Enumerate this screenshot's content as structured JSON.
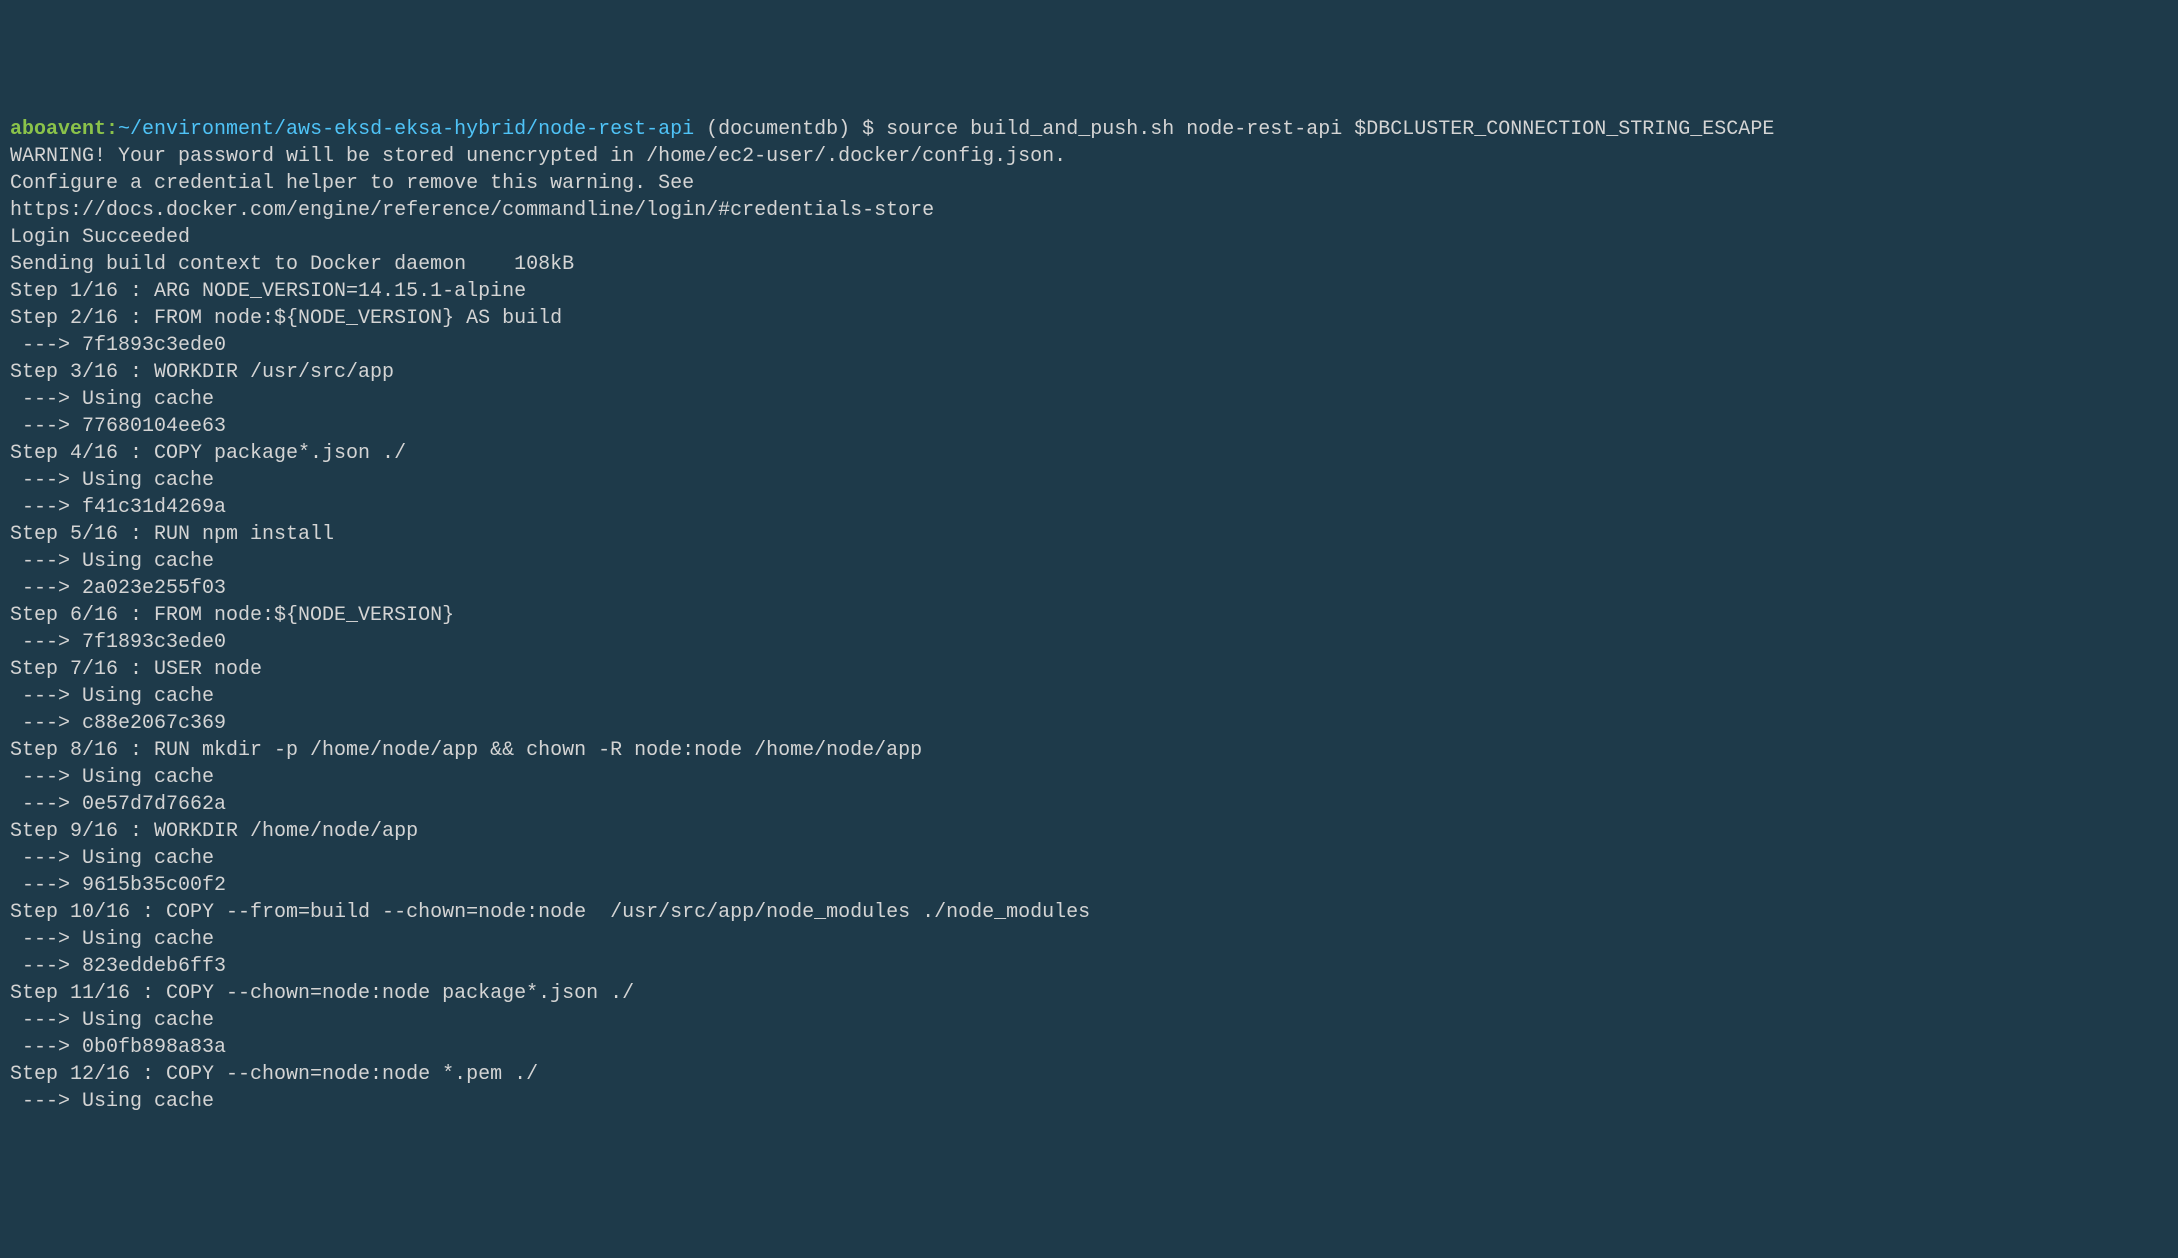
{
  "prompt": {
    "user": "aboavent",
    "separator": ":",
    "path": "~/environment/aws-eksd-eksa-hybrid/node-rest-api",
    "branch": " (documentdb) ",
    "symbol": "$ ",
    "command": "source build_and_push.sh node-rest-api $DBCLUSTER_CONNECTION_STRING_ESCAPE"
  },
  "lines": [
    "WARNING! Your password will be stored unencrypted in /home/ec2-user/.docker/config.json.",
    "Configure a credential helper to remove this warning. See",
    "https://docs.docker.com/engine/reference/commandline/login/#credentials-store",
    "",
    "Login Succeeded",
    "Sending build context to Docker daemon    108kB",
    "Step 1/16 : ARG NODE_VERSION=14.15.1-alpine",
    "Step 2/16 : FROM node:${NODE_VERSION} AS build",
    " ---> 7f1893c3ede0",
    "Step 3/16 : WORKDIR /usr/src/app",
    " ---> Using cache",
    " ---> 77680104ee63",
    "Step 4/16 : COPY package*.json ./",
    " ---> Using cache",
    " ---> f41c31d4269a",
    "Step 5/16 : RUN npm install",
    " ---> Using cache",
    " ---> 2a023e255f03",
    "Step 6/16 : FROM node:${NODE_VERSION}",
    " ---> 7f1893c3ede0",
    "Step 7/16 : USER node",
    " ---> Using cache",
    " ---> c88e2067c369",
    "Step 8/16 : RUN mkdir -p /home/node/app && chown -R node:node /home/node/app",
    " ---> Using cache",
    " ---> 0e57d7d7662a",
    "Step 9/16 : WORKDIR /home/node/app",
    " ---> Using cache",
    " ---> 9615b35c00f2",
    "Step 10/16 : COPY --from=build --chown=node:node  /usr/src/app/node_modules ./node_modules",
    " ---> Using cache",
    " ---> 823eddeb6ff3",
    "Step 11/16 : COPY --chown=node:node package*.json ./",
    " ---> Using cache",
    " ---> 0b0fb898a83a",
    "Step 12/16 : COPY --chown=node:node *.pem ./",
    " ---> Using cache"
  ]
}
